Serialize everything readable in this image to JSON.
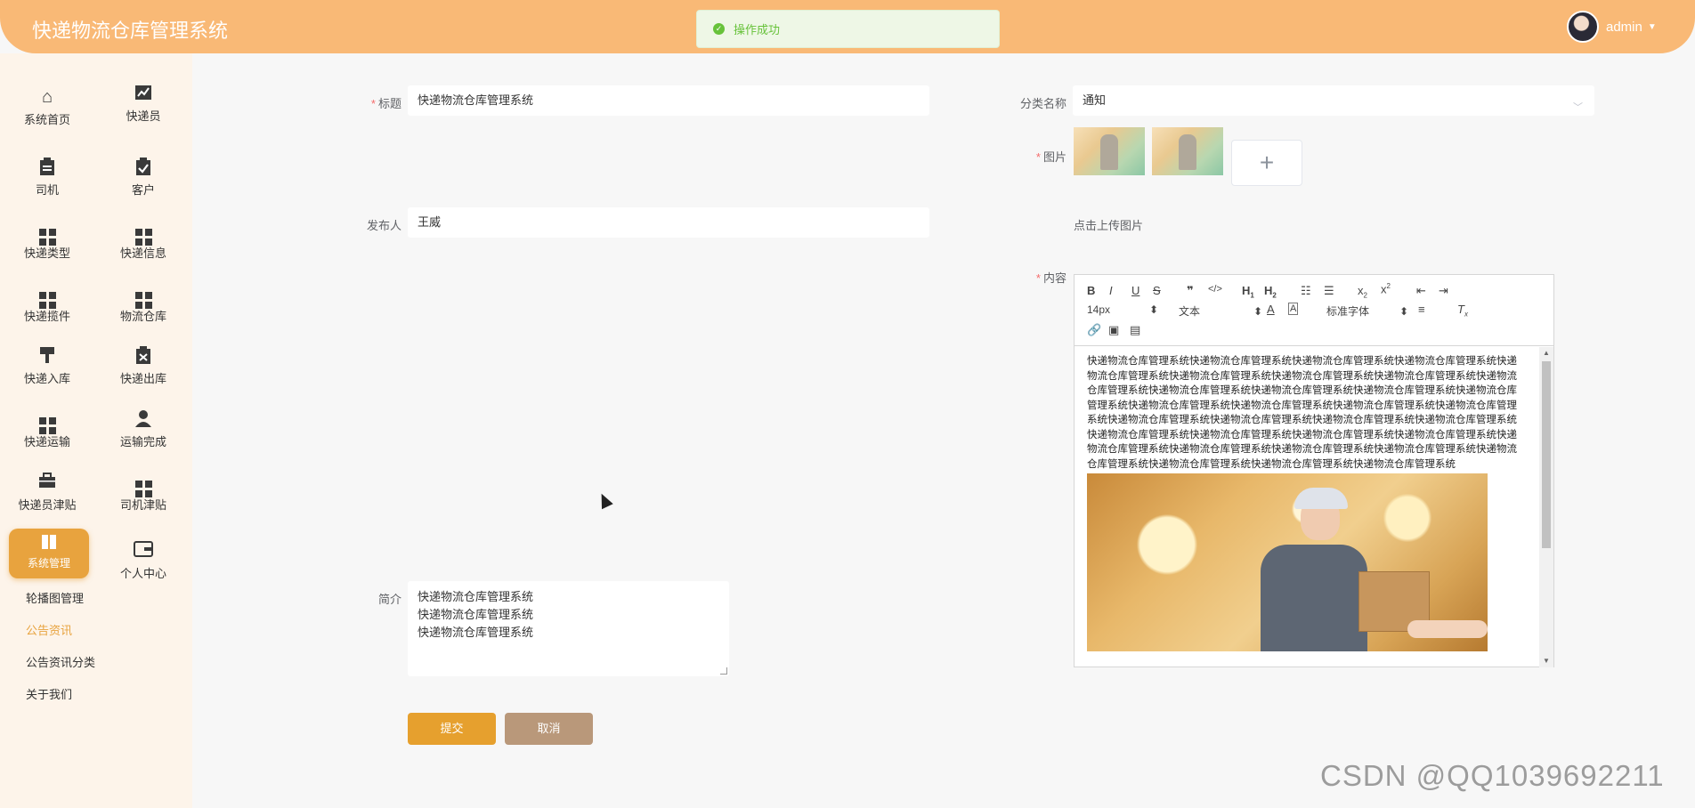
{
  "header": {
    "app_title": "快递物流仓库管理系统",
    "toast": "操作成功",
    "username": "admin"
  },
  "sidebar": {
    "items": [
      {
        "label": "系统首页",
        "icon": "home-icon"
      },
      {
        "label": "快递员",
        "icon": "chart-icon"
      },
      {
        "label": "司机",
        "icon": "clipboard-icon"
      },
      {
        "label": "客户",
        "icon": "clipboard-check-icon"
      },
      {
        "label": "快递类型",
        "icon": "grid-icon"
      },
      {
        "label": "快递信息",
        "icon": "grid-icon"
      },
      {
        "label": "快递揽件",
        "icon": "grid-icon"
      },
      {
        "label": "物流仓库",
        "icon": "grid-icon"
      },
      {
        "label": "快递入库",
        "icon": "brush-icon"
      },
      {
        "label": "快递出库",
        "icon": "clipboard-x-icon"
      },
      {
        "label": "快递运输",
        "icon": "grid-icon"
      },
      {
        "label": "运输完成",
        "icon": "user-icon"
      },
      {
        "label": "快递员津贴",
        "icon": "briefcase-icon"
      },
      {
        "label": "司机津贴",
        "icon": "grid-icon"
      },
      {
        "label": "系统管理",
        "icon": "book-icon"
      },
      {
        "label": "个人中心",
        "icon": "wallet-icon"
      }
    ],
    "sub_items": [
      "轮播图管理",
      "公告资讯",
      "公告资讯分类",
      "关于我们"
    ]
  },
  "form": {
    "title_label": "标题",
    "title_value": "快递物流仓库管理系统",
    "category_label": "分类名称",
    "category_value": "通知",
    "image_label": "图片",
    "upload_tip": "点击上传图片",
    "publisher_label": "发布人",
    "publisher_value": "王威",
    "content_label": "内容",
    "intro_label": "简介",
    "intro_lines": [
      "快递物流仓库管理系统",
      "快递物流仓库管理系统",
      "快递物流仓库管理系统"
    ],
    "submit_label": "提交",
    "cancel_label": "取消"
  },
  "editor": {
    "font_size": "14px",
    "text_type": "文本",
    "font_family": "标准字体",
    "content_text": "快递物流仓库管理系统快递物流仓库管理系统快递物流仓库管理系统快递物流仓库管理系统快递物流仓库管理系统快递物流仓库管理系统快递物流仓库管理系统快递物流仓库管理系统快递物流仓库管理系统快递物流仓库管理系统快递物流仓库管理系统快递物流仓库管理系统快递物流仓库管理系统快递物流仓库管理系统快递物流仓库管理系统快递物流仓库管理系统快递物流仓库管理系统快递物流仓库管理系统快递物流仓库管理系统快递物流仓库管理系统快递物流仓库管理系统快递物流仓库管理系统快递物流仓库管理系统快递物流仓库管理系统快递物流仓库管理系统快递物流仓库管理系统快递物流仓库管理系统快递物流仓库管理系统快递物流仓库管理系统快递物流仓库管理系统快递物流仓库管理系统快递物流仓库管理系统快递物流仓库管理系统"
  },
  "watermark": "CSDN @QQ1039692211",
  "colors": {
    "header": "#f9b976",
    "sidebar": "#fdf4ea",
    "accent": "#e8a33e",
    "submit": "#e6a02e",
    "cancel": "#b9987a",
    "success": "#67c23a"
  }
}
